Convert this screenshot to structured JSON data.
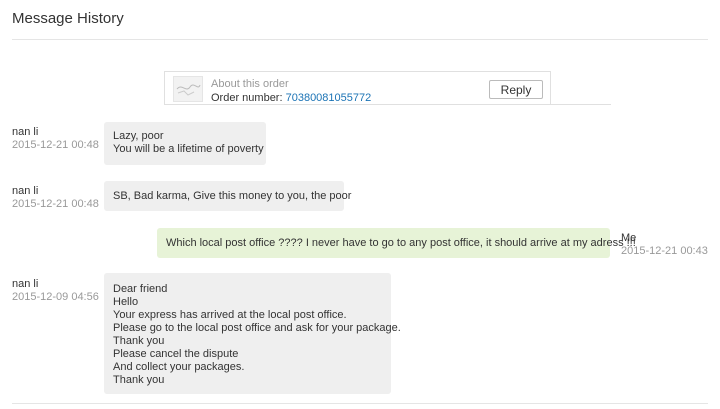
{
  "page": {
    "title": "Message History"
  },
  "order": {
    "about": "About this order",
    "number_label": "Order number: ",
    "number": "70380081055772",
    "reply_label": "Reply"
  },
  "messages": [
    {
      "sender": "nan li",
      "time": "2015-12-21 00:48",
      "lines": [
        "Lazy, poor",
        "You will be a lifetime of poverty"
      ]
    },
    {
      "sender": "nan li",
      "time": "2015-12-21 00:48",
      "lines": [
        "SB, Bad karma, Give this money to you, the poor"
      ]
    },
    {
      "sender": "Me",
      "time": "2015-12-21 00:43",
      "lines": [
        "Which local post office ???? I never have to go to any post office, it should arrive at my adress !!!"
      ]
    },
    {
      "sender": "nan li",
      "time": "2015-12-09 04:56",
      "lines": [
        "Dear friend",
        "Hello",
        "Your express has arrived at the local post office.",
        "Please go to the local post office and ask for your package.",
        "Thank you",
        "Please cancel the dispute",
        "And collect your packages.",
        "Thank you"
      ]
    }
  ],
  "colors": {
    "link": "#1b73b5",
    "my_bubble": "#e7f3d7",
    "their_bubble": "#efefef"
  }
}
